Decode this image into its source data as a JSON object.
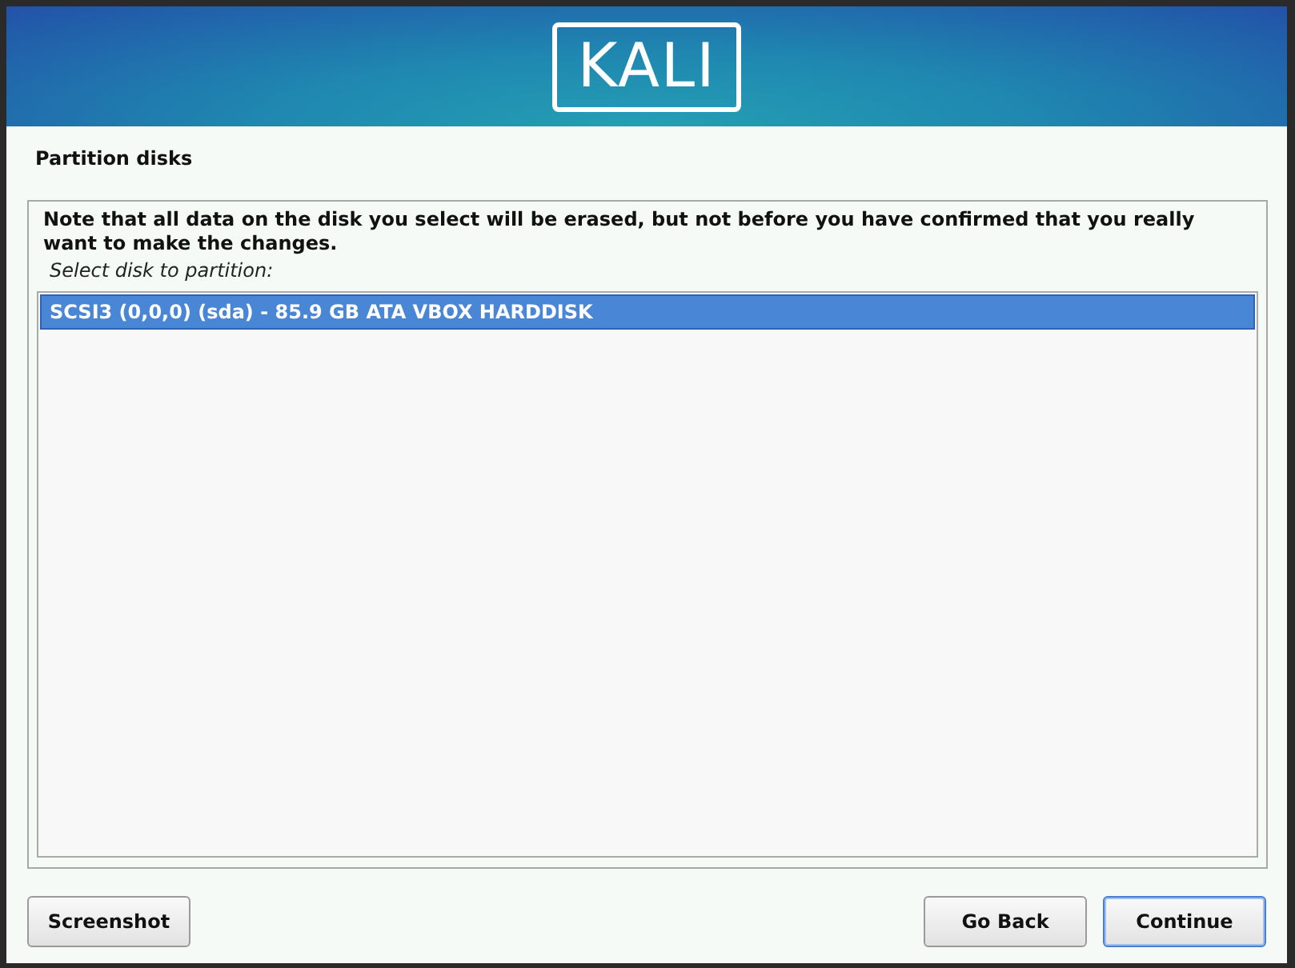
{
  "banner": {
    "logo": "KALI"
  },
  "title": "Partition disks",
  "note": "Note that all data on the disk you select will be erased, but not before you have confirmed that you really want to make the changes.",
  "prompt": "Select disk to partition:",
  "disks": [
    {
      "label": "SCSI3 (0,0,0) (sda) - 85.9 GB ATA VBOX HARDDISK",
      "selected": true
    }
  ],
  "buttons": [
    {
      "label": "Screenshot",
      "kind": "left",
      "focused": false
    },
    {
      "label": "Go Back",
      "kind": "right",
      "focused": false
    },
    {
      "label": "Continue",
      "kind": "right",
      "focused": true
    }
  ]
}
